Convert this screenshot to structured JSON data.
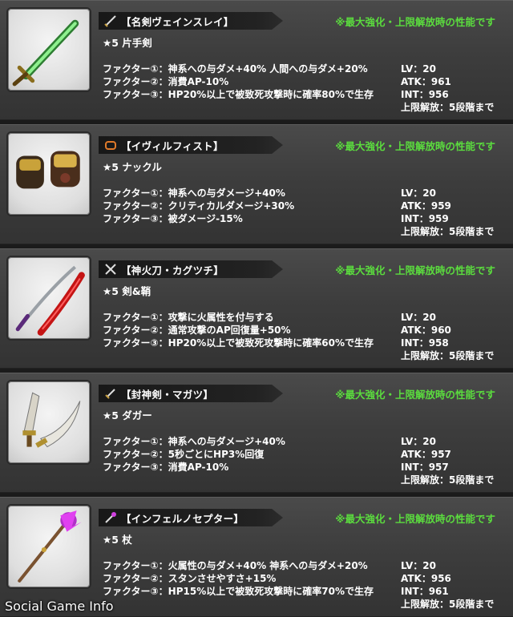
{
  "note_text": "※最大強化・上限解放時の性能です",
  "watermark": "Social Game Info",
  "cards": [
    {
      "name": "【名剣ヴェインスレイ】",
      "type_icon": "sword-icon",
      "rarity": "★5 片手剣",
      "factors": [
        "ファクター①：神系への与ダメ+40% 人間への与ダメ+20%",
        "ファクター②：消費AP-10%",
        "ファクター③：HP20%以上で被致死攻撃時に確率80%で生存"
      ],
      "stats": [
        "LV：20",
        "ATK：961",
        "INT：956",
        "上限解放：5段階まで"
      ]
    },
    {
      "name": "【イヴィルフィスト】",
      "type_icon": "knuckle-icon",
      "rarity": "★5 ナックル",
      "factors": [
        "ファクター①：神系への与ダメージ+40%",
        "ファクター②：クリティカルダメージ+30%",
        "ファクター③：被ダメージ-15%"
      ],
      "stats": [
        "LV：20",
        "ATK：959",
        "INT：959",
        "上限解放：5段階まで"
      ]
    },
    {
      "name": "【神火刀・カグツチ】",
      "type_icon": "crossed-swords-icon",
      "rarity": "★5 剣&鞘",
      "factors": [
        "ファクター①：攻撃に火属性を付与する",
        "ファクター②：通常攻撃のAP回復量+50%",
        "ファクター③：HP20%以上で被致死攻撃時に確率60%で生存"
      ],
      "stats": [
        "LV：20",
        "ATK：960",
        "INT：958",
        "上限解放：5段階まで"
      ]
    },
    {
      "name": "【封神剣・マガツ】",
      "type_icon": "dagger-icon",
      "rarity": "★5 ダガー",
      "factors": [
        "ファクター①：神系への与ダメージ+40%",
        "ファクター②：5秒ごとにHP3%回復",
        "ファクター③：消費AP-10%"
      ],
      "stats": [
        "LV：20",
        "ATK：957",
        "INT：957",
        "上限解放：5段階まで"
      ]
    },
    {
      "name": "【インフェルノセプター】",
      "type_icon": "staff-icon",
      "rarity": "★5 杖",
      "factors": [
        "ファクター①：火属性の与ダメ+40% 神系への与ダメ+20%",
        "ファクター②：スタンさせやすさ+15%",
        "ファクター③：HP15%以上で被致死攻撃時に確率70%で生存"
      ],
      "stats": [
        "LV：20",
        "ATK：956",
        "INT：961",
        "上限解放：5段階まで"
      ]
    }
  ]
}
